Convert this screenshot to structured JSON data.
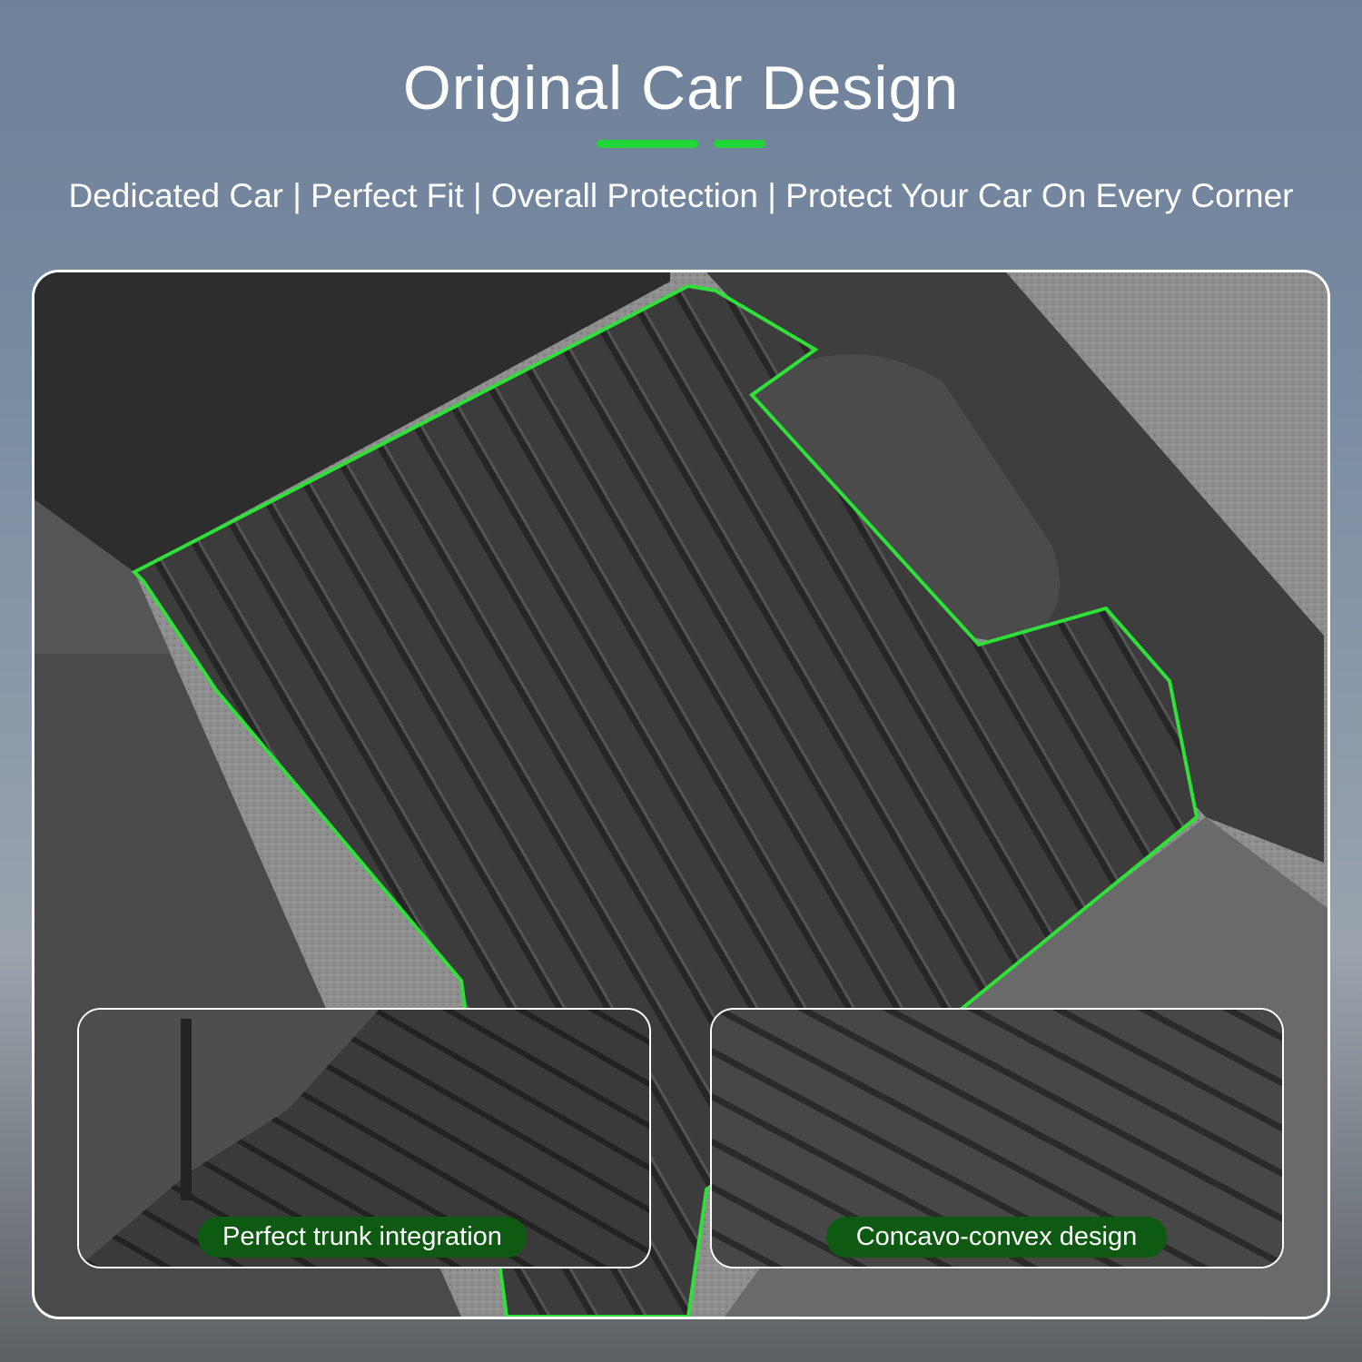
{
  "header": {
    "title": "Original Car Design",
    "subtitle": "Dedicated Car | Perfect Fit | Overall Protection | Protect Your Car On Every Corner"
  },
  "insets": [
    {
      "label": "Perfect trunk integration"
    },
    {
      "label": "Concavo-convex design"
    }
  ],
  "colors": {
    "accent": "#22d63a",
    "badge": "#0f5a12",
    "background": "#73859c"
  }
}
